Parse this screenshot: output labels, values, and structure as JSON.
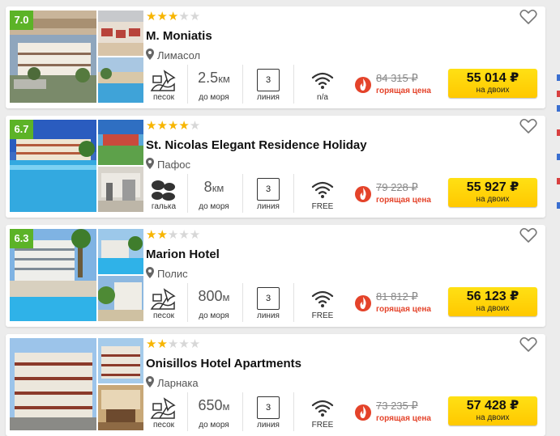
{
  "colors": {
    "rating_bg": "#5cb327",
    "star_on": "#f7b500",
    "star_off": "#d7d7d7",
    "hot_price": "#e4432a",
    "price_button": "#ffd000"
  },
  "icons": {
    "location": "location-pin-icon",
    "favorite": "heart-icon",
    "sand_beach": "sand-beach-icon",
    "pebble_beach": "pebble-beach-icon",
    "wifi": "wifi-icon",
    "hot_offer": "fire-icon"
  },
  "hotels": [
    {
      "rating": "7.0",
      "stars": 3,
      "name": "M. Moniatis",
      "city": "Лимасол",
      "beach_type": "sand",
      "beach_label": "песок",
      "distance_value": "2.5",
      "distance_unit": "км",
      "distance_label": "до моря",
      "line_value": "3",
      "line_label": "линия",
      "wifi_label": "n/a",
      "old_price": "84 315 ₽",
      "hot_label": "горящая цена",
      "price": "55 014 ₽",
      "price_caption": "на двоих"
    },
    {
      "rating": "6.7",
      "stars": 4,
      "name": "St. Nicolas Elegant Residence Holiday",
      "city": "Пафос",
      "beach_type": "pebble",
      "beach_label": "галька",
      "distance_value": "8",
      "distance_unit": "км",
      "distance_label": "до моря",
      "line_value": "3",
      "line_label": "линия",
      "wifi_label": "FREE",
      "old_price": "79 228 ₽",
      "hot_label": "горящая цена",
      "price": "55 927 ₽",
      "price_caption": "на двоих"
    },
    {
      "rating": "6.3",
      "stars": 2,
      "name": "Marion Hotel",
      "city": "Полис",
      "beach_type": "sand",
      "beach_label": "песок",
      "distance_value": "800",
      "distance_unit": "м",
      "distance_label": "до моря",
      "line_value": "3",
      "line_label": "линия",
      "wifi_label": "FREE",
      "old_price": "81 812 ₽",
      "hot_label": "горящая цена",
      "price": "56 123 ₽",
      "price_caption": "на двоих"
    },
    {
      "rating": "",
      "stars": 2,
      "name": "Onisillos Hotel Apartments",
      "city": "Ларнака",
      "beach_type": "sand",
      "beach_label": "песок",
      "distance_value": "650",
      "distance_unit": "м",
      "distance_label": "до моря",
      "line_value": "3",
      "line_label": "линия",
      "wifi_label": "FREE",
      "old_price": "73 235 ₽",
      "hot_label": "горящая цена",
      "price": "57 428 ₽",
      "price_caption": "на двоих"
    }
  ]
}
